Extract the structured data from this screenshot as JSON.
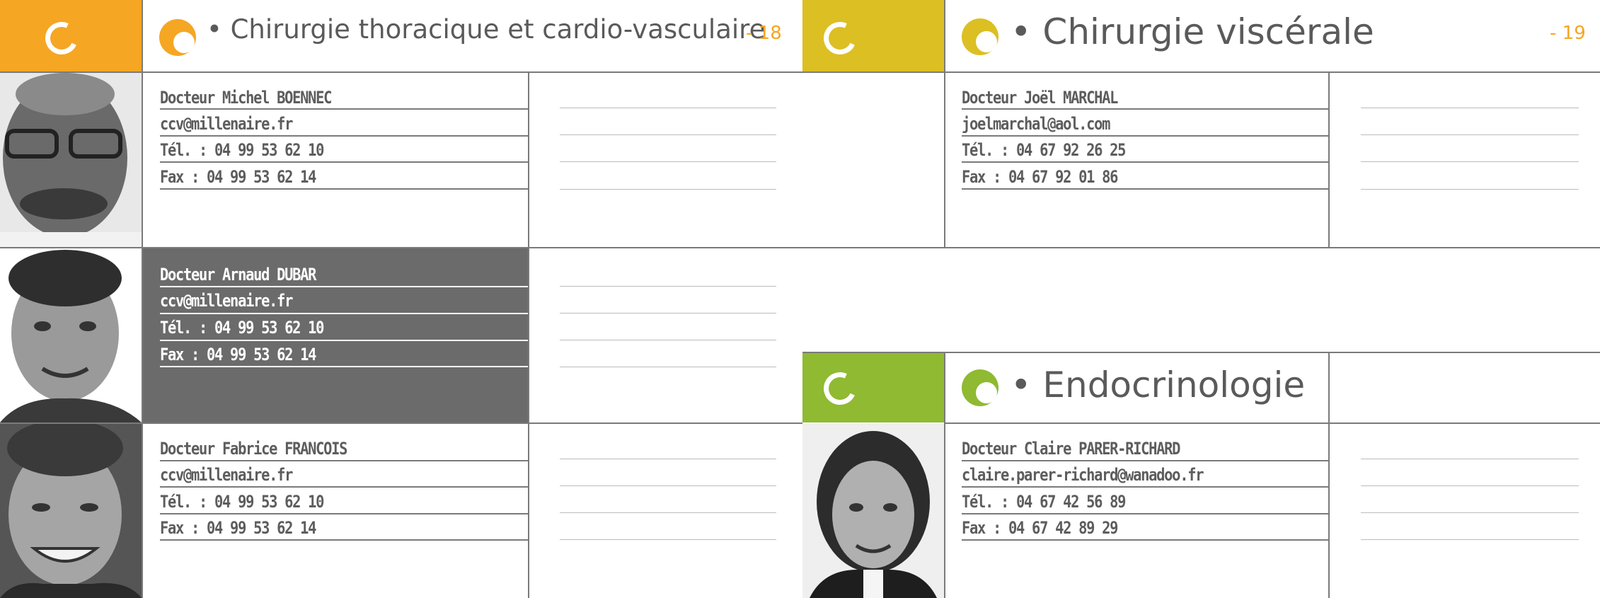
{
  "colors": {
    "orange": "#f5a623",
    "yellow": "#dcbf22",
    "green": "#8fba32",
    "dark_panel": "#6b6b6c",
    "text_gray": "#5a5a5a",
    "rule_gray": "#7a7a7a"
  },
  "sections": {
    "thoracic": {
      "title": "Chirurgie thoracique et cardio-vasculaire",
      "bullet": "•",
      "page": "- 18",
      "logo_icon": "circle-arc-icon"
    },
    "visceral": {
      "title": "Chirurgie viscérale",
      "bullet": "•",
      "page": "- 19",
      "logo_icon": "circle-arc-icon"
    },
    "endocrino": {
      "title": "Endocrinologie",
      "bullet": "•",
      "logo_icon": "circle-arc-icon"
    }
  },
  "doctors": [
    {
      "name": "Docteur Michel BOENNEC",
      "email": "ccv@millenaire.fr",
      "tel": "Tél. : 04 99 53 62 10",
      "fax": "Fax : 04 99 53 62 14"
    },
    {
      "name": "Docteur Arnaud DUBAR",
      "email": "ccv@millenaire.fr",
      "tel": "Tél. : 04 99 53 62 10",
      "fax": "Fax : 04 99 53 62 14"
    },
    {
      "name": "Docteur Fabrice FRANCOIS",
      "email": "ccv@millenaire.fr",
      "tel": "Tél. : 04 99 53 62 10",
      "fax": "Fax : 04 99 53 62 14"
    },
    {
      "name": "Docteur Joël MARCHAL",
      "email": "joelmarchal@aol.com",
      "tel": "Tél. : 04 67 92 26 25",
      "fax": "Fax : 04 67 92 01 86"
    },
    {
      "name": "Docteur Claire PARER-RICHARD",
      "email": "claire.parer-richard@wanadoo.fr",
      "tel": "Tél. : 04 67 42 56 89",
      "fax": "Fax : 04 67 42 89 29"
    }
  ]
}
